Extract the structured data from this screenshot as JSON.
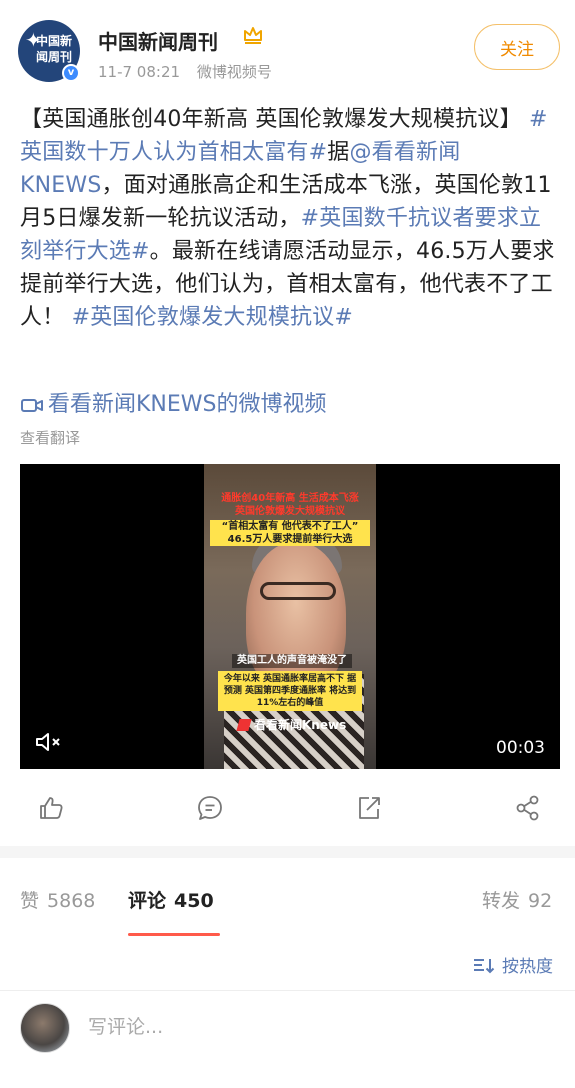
{
  "header": {
    "author": "中国新闻周刊",
    "avatar_text": "中国新闻周刊",
    "timestamp": "11-7 08:21",
    "source": "微博视频号",
    "follow_label": "关注",
    "icons": [
      "crown-icon",
      "verified-icon"
    ]
  },
  "post": {
    "segments": [
      {
        "text": "【英国通胀创40年新高 英国伦敦爆发大规模抗议】 ",
        "type": "text"
      },
      {
        "text": "#英国数十万人认为首相太富有#",
        "type": "link"
      },
      {
        "text": "据",
        "type": "text"
      },
      {
        "text": "@看看新闻KNEWS",
        "type": "link"
      },
      {
        "text": "，面对通胀高企和生活成本飞涨，英国伦敦11月5日爆发新一轮抗议活动，",
        "type": "text"
      },
      {
        "text": "#英国数千抗议者要求立刻举行大选#",
        "type": "link"
      },
      {
        "text": "。最新在线请愿活动显示，46.5万人要求提前举行大选，他们认为，首相太富有，他代表不了工人！ ",
        "type": "text"
      },
      {
        "text": "#英国伦敦爆发大规模抗议#",
        "type": "link"
      }
    ],
    "video_link": "看看新闻KNEWS的微博视频",
    "translate_label": "查看翻译"
  },
  "video": {
    "banner_line1": "通胀创40年新高 生活成本飞涨",
    "banner_line2": "英国伦敦爆发大规模抗议",
    "banner_line3": "“首相太富有 他代表不了工人”",
    "banner_line4": "46.5万人要求提前举行大选",
    "subtitle1": "英国工人的声音被淹没了",
    "subtitle2": "今年以来 英国通胀率居高不下 据预测 英国第四季度通胀率 将达到11%左右的峰值",
    "logo_text": "看看新闻Knews",
    "duration": "00:03"
  },
  "actions": [
    "like-icon",
    "comment-icon",
    "repost-icon",
    "share-icon"
  ],
  "tabs": {
    "like_label": "赞",
    "like_count": "5868",
    "comment_label": "评论",
    "comment_count": "450",
    "repost_label": "转发",
    "repost_count": "92"
  },
  "sort_label": "按热度",
  "comment_input": {
    "placeholder": "写评论..."
  },
  "colors": {
    "link": "#5b7bb5",
    "follow": "#f08a00",
    "accent_underline": "#ff5a4a"
  }
}
